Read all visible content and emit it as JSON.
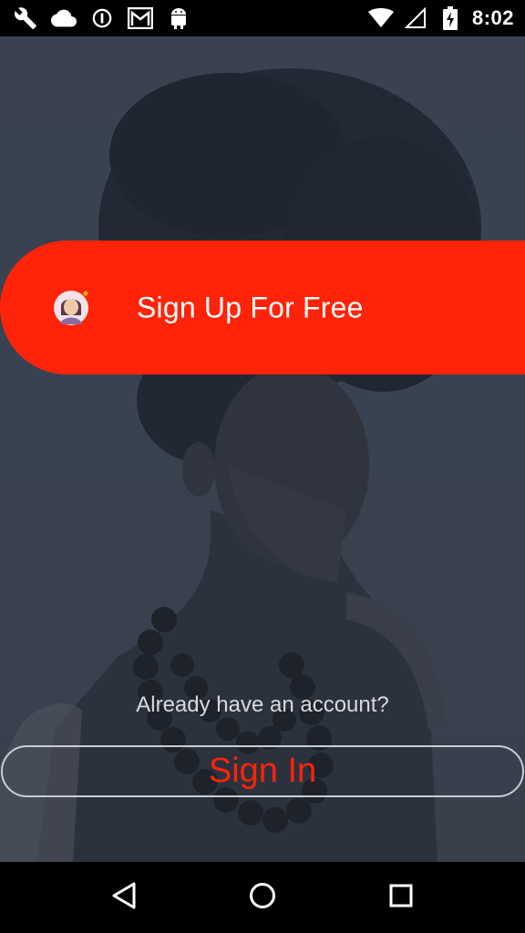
{
  "status_bar": {
    "time": "8:02",
    "left_icons": [
      "wrench-icon",
      "cloud-icon",
      "info-circle-icon",
      "gmail-icon",
      "android-icon"
    ],
    "right_icons": [
      "wifi-icon",
      "cell-signal-icon",
      "battery-charging-icon"
    ]
  },
  "hero": {
    "signup_label": "Sign Up For Free",
    "avatar_icon": "user-avatar-icon",
    "already_text": "Already have an account?",
    "signin_label": "Sign In"
  },
  "colors": {
    "accent": "#ff2309",
    "overlay": "#3a4150",
    "text_muted": "#d7d9dd"
  },
  "nav_bar": {
    "icons": [
      "back-icon",
      "home-icon",
      "recents-icon"
    ]
  }
}
